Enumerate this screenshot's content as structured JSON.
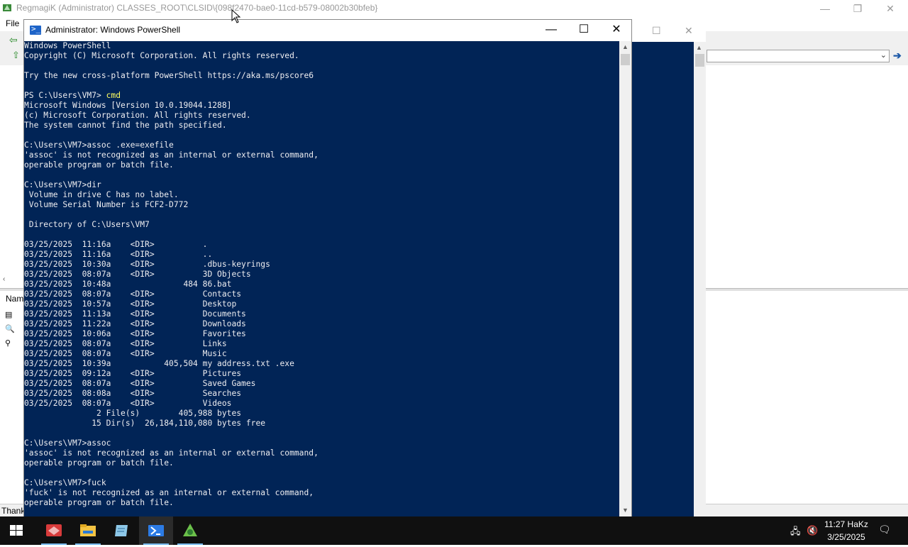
{
  "background_window": {
    "title": "RegmagiK (Administrator) CLASSES_ROOT\\CLSID\\{098f2470-bae0-11cd-b579-08002b30bfeb}",
    "menu_file": "File",
    "lower_header": "Nam",
    "status_text": "Thank",
    "controls": {
      "minimize": "—",
      "restore": "❐",
      "close": "✕"
    }
  },
  "powershell": {
    "title": "Administrator: Windows PowerShell",
    "controls": {
      "minimize": "—",
      "maximize": "☐",
      "close": "✕"
    },
    "lines": [
      "Windows PowerShell",
      "Copyright (C) Microsoft Corporation. All rights reserved.",
      "",
      "Try the new cross-platform PowerShell https://aka.ms/pscore6",
      "",
      "PS C:\\Users\\VM7> ",
      "Microsoft Windows [Version 10.0.19044.1288]",
      "(c) Microsoft Corporation. All rights reserved.",
      "The system cannot find the path specified.",
      "",
      "C:\\Users\\VM7>assoc .exe=exefile",
      "'assoc' is not recognized as an internal or external command,",
      "operable program or batch file.",
      "",
      "C:\\Users\\VM7>dir",
      " Volume in drive C has no label.",
      " Volume Serial Number is FCF2-D772",
      "",
      " Directory of C:\\Users\\VM7",
      "",
      "03/25/2025  11:16a    <DIR>          .",
      "03/25/2025  11:16a    <DIR>          ..",
      "03/25/2025  10:30a    <DIR>          .dbus-keyrings",
      "03/25/2025  08:07a    <DIR>          3D Objects",
      "03/25/2025  10:48a               484 86.bat",
      "03/25/2025  08:07a    <DIR>          Contacts",
      "03/25/2025  10:57a    <DIR>          Desktop",
      "03/25/2025  11:13a    <DIR>          Documents",
      "03/25/2025  11:22a    <DIR>          Downloads",
      "03/25/2025  10:06a    <DIR>          Favorites",
      "03/25/2025  08:07a    <DIR>          Links",
      "03/25/2025  08:07a    <DIR>          Music",
      "03/25/2025  10:39a           405,504 my address.txt .exe",
      "03/25/2025  09:12a    <DIR>          Pictures",
      "03/25/2025  08:07a    <DIR>          Saved Games",
      "03/25/2025  08:08a    <DIR>          Searches",
      "03/25/2025  08:07a    <DIR>          Videos",
      "               2 File(s)        405,988 bytes",
      "              15 Dir(s)  26,184,110,080 bytes free",
      "",
      "C:\\Users\\VM7>assoc",
      "'assoc' is not recognized as an internal or external command,",
      "operable program or batch file.",
      "",
      "C:\\Users\\VM7>fuck",
      "'fuck' is not recognized as an internal or external command,",
      "operable program or batch file."
    ],
    "ps_command": "cmd"
  },
  "taskbar": {
    "clock_time": "11:27 HaKz",
    "clock_date": "3/25/2025",
    "apps": [
      "app-red-icon",
      "file-explorer-icon",
      "notepad-icon",
      "powershell-icon",
      "regmagik-icon"
    ]
  }
}
